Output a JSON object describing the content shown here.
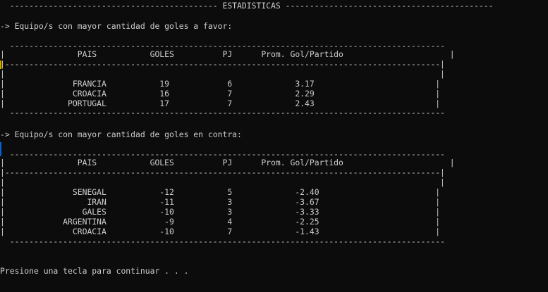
{
  "header": "  ------------------------------------------- ESTADISTICAS -------------------------------------------",
  "section_favor": {
    "title": "-> Equipo/s con mayor cantidad de goles a favor:",
    "top_border": "  ------------------------------------------------------------------------------------------",
    "header_row": "|               PAIS           GOLES          PJ      Prom. Gol/Partido                      |",
    "divider": "|------------------------------------------------------------------------------------------|",
    "blank_row": "|                                                                                          |",
    "rows": [
      "|              FRANCIA           19            6             3.17                         |",
      "|              CROACIA           16            7             2.29                         |",
      "|             PORTUGAL           17            7             2.43                         |"
    ],
    "bottom_border": "  ------------------------------------------------------------------------------------------"
  },
  "section_contra": {
    "title": "-> Equipo/s con mayor cantidad de goles en contra:",
    "top_border": "  ------------------------------------------------------------------------------------------",
    "header_row": "|               PAIS           GOLES          PJ      Prom. Gol/Partido                      |",
    "divider": "|------------------------------------------------------------------------------------------|",
    "blank_row": "|                                                                                          |",
    "rows": [
      "|              SENEGAL           -12           5             -2.40                        |",
      "|                 IRAN           -11           3             -3.67                        |",
      "|                GALES           -10           3             -3.33                        |",
      "|            ARGENTINA            -9           4             -2.25                        |",
      "|              CROACIA           -10           7             -1.43                        |"
    ],
    "bottom_border": "  ------------------------------------------------------------------------------------------"
  },
  "prompt": "Presione una tecla para continuar . . .",
  "colors": {
    "background": "#0c0c0c",
    "text": "#cccccc",
    "cursor": "#c8a800"
  }
}
